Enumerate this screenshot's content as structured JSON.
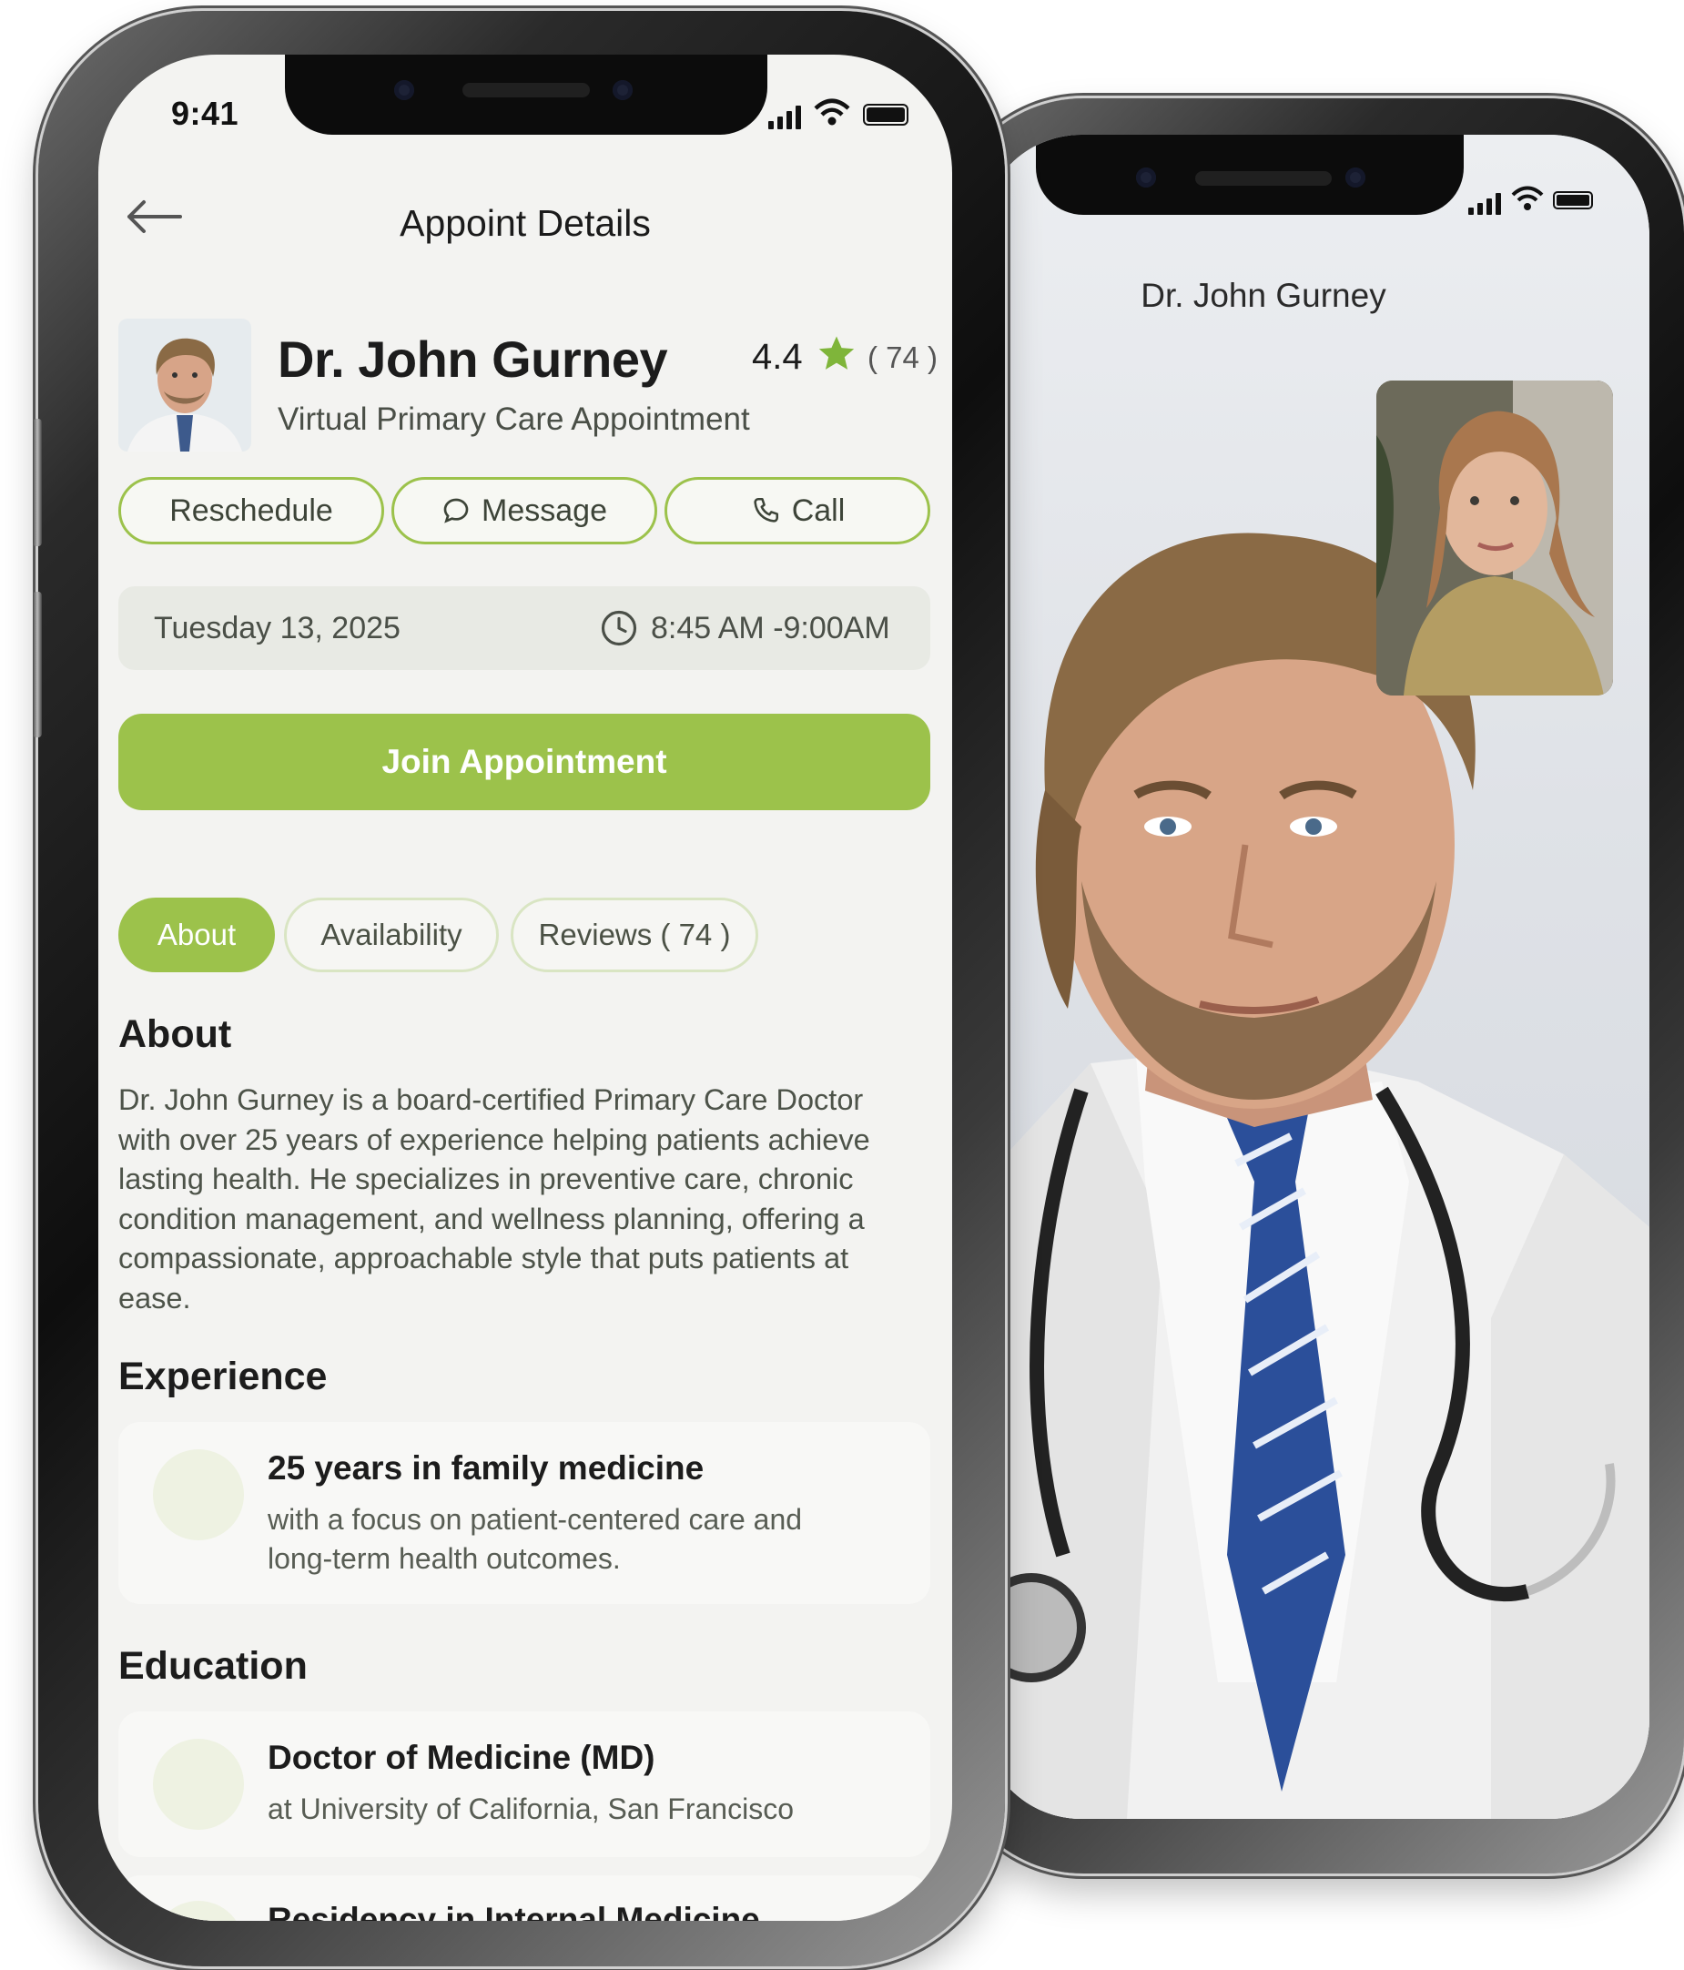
{
  "front": {
    "status": {
      "time": "9:41"
    },
    "header": {
      "title": "Appoint Details"
    },
    "doctor": {
      "name": "Dr. John Gurney",
      "specialty": "Virtual Primary Care Appointment",
      "rating": "4.4",
      "rating_count": "( 74 )"
    },
    "actions": {
      "reschedule": "Reschedule",
      "message": "Message",
      "call": "Call"
    },
    "appointment": {
      "date": "Tuesday 13, 2025",
      "time": "8:45 AM -9:00AM"
    },
    "join_label": "Join Appointment",
    "tabs": [
      "About",
      "Availability",
      "Reviews ( 74 )"
    ],
    "about": {
      "heading": "About",
      "lines": [
        "Dr. John Gurney is a board-certified Primary Care Doctor",
        "with over 25 years of experience helping patients achieve",
        "lasting health. He specializes in preventive care, chronic",
        "condition management, and wellness planning, offering a",
        "compassionate, approachable style that puts patients at",
        "ease."
      ]
    },
    "experience": {
      "heading": "Experience",
      "title": "25 years in family medicine",
      "sub_lines": [
        "with a focus on patient-centered care and",
        "long-term health outcomes."
      ]
    },
    "education": {
      "heading": "Education",
      "title": "Doctor of Medicine (MD)",
      "sub": "at University of California, San Francisco",
      "next_title": "Residency in Internal Medicine"
    }
  },
  "back": {
    "caller_name": "Dr. John Gurney"
  },
  "colors": {
    "accent": "#9cc24b",
    "accent_light": "#d9e5c3",
    "star": "#7fb53a",
    "screen_bg": "#f3f3f1"
  },
  "icons": [
    "back-arrow-icon",
    "star-icon",
    "chat-icon",
    "phone-icon",
    "clock-icon",
    "signal-icon",
    "wifi-icon",
    "battery-icon"
  ]
}
